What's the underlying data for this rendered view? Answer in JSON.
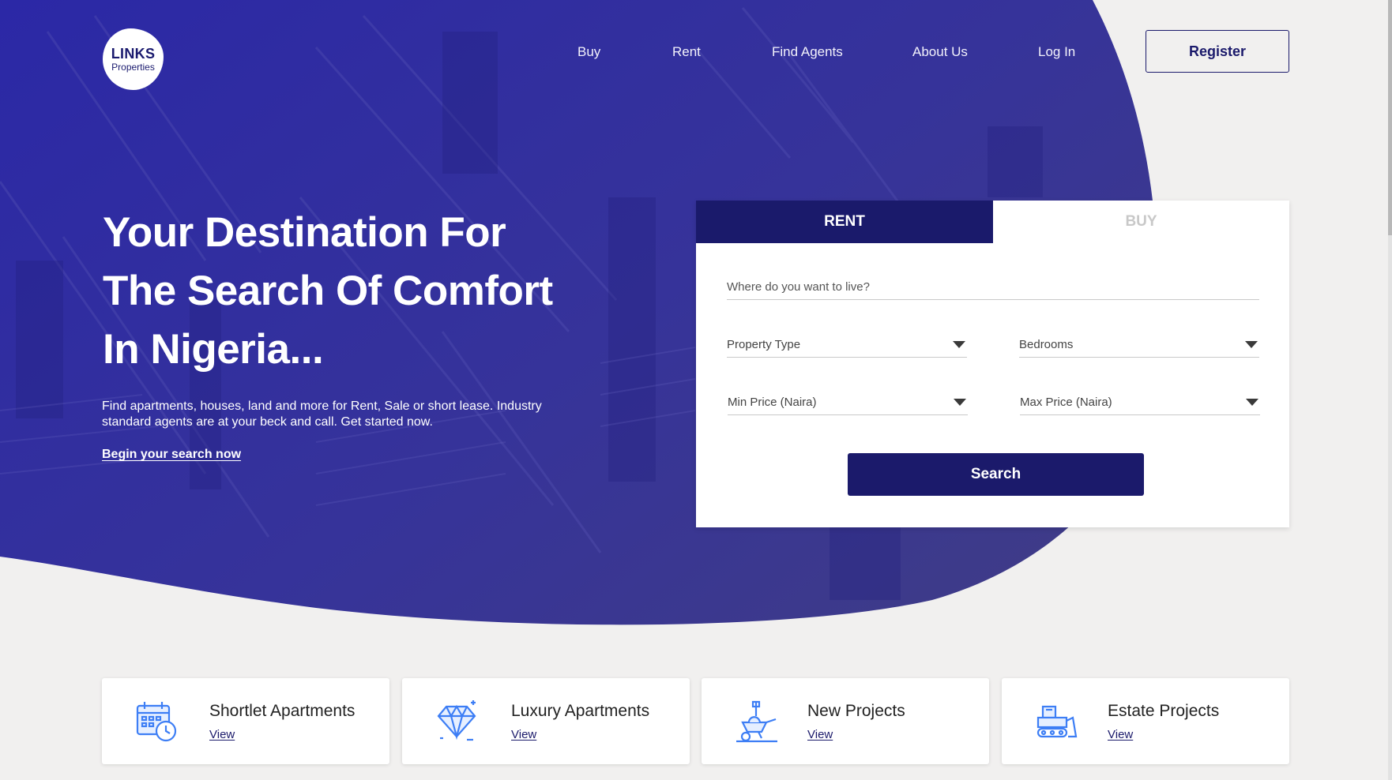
{
  "brand": {
    "logo_line1": "LINKS",
    "logo_line2": "Properties"
  },
  "nav": {
    "links": [
      "Buy",
      "Rent",
      "Find Agents",
      "About Us",
      "Log In"
    ],
    "register_label": "Register"
  },
  "hero": {
    "headline_lines": [
      "Your Destination For",
      "The Search Of Comfort",
      "In Nigeria..."
    ],
    "subtitle_line1": "Find apartments, houses, land and more for Rent, Sale or short lease. Industry",
    "subtitle_line2": "standard agents are at your beck and call. Get started now.",
    "cta_link": "Begin your search now"
  },
  "search_panel": {
    "tabs": [
      {
        "label": "RENT",
        "active": true
      },
      {
        "label": "BUY",
        "active": false
      }
    ],
    "location_placeholder": "Where do you want to live?",
    "property_type": "Property Type",
    "bedrooms": "Bedrooms",
    "min_price": "Min Price (Naira)",
    "max_price": "Max Price (Naira)",
    "search_label": "Search"
  },
  "categories": [
    {
      "title": "Shortlet Apartments",
      "link": "View",
      "icon": "calendar-clock-icon"
    },
    {
      "title": "Luxury Apartments",
      "link": "View",
      "icon": "diamond-icon"
    },
    {
      "title": "New Projects",
      "link": "View",
      "icon": "wheelbarrow-icon"
    },
    {
      "title": "Estate Projects",
      "link": "View",
      "icon": "bulldozer-icon"
    }
  ],
  "colors": {
    "primary": "#1b1a6b",
    "hero_gradient_start": "#2a27a8",
    "hero_gradient_end": "#3c3989",
    "page_background": "#f1f0ef",
    "icon_blue": "#3d7ef5"
  }
}
